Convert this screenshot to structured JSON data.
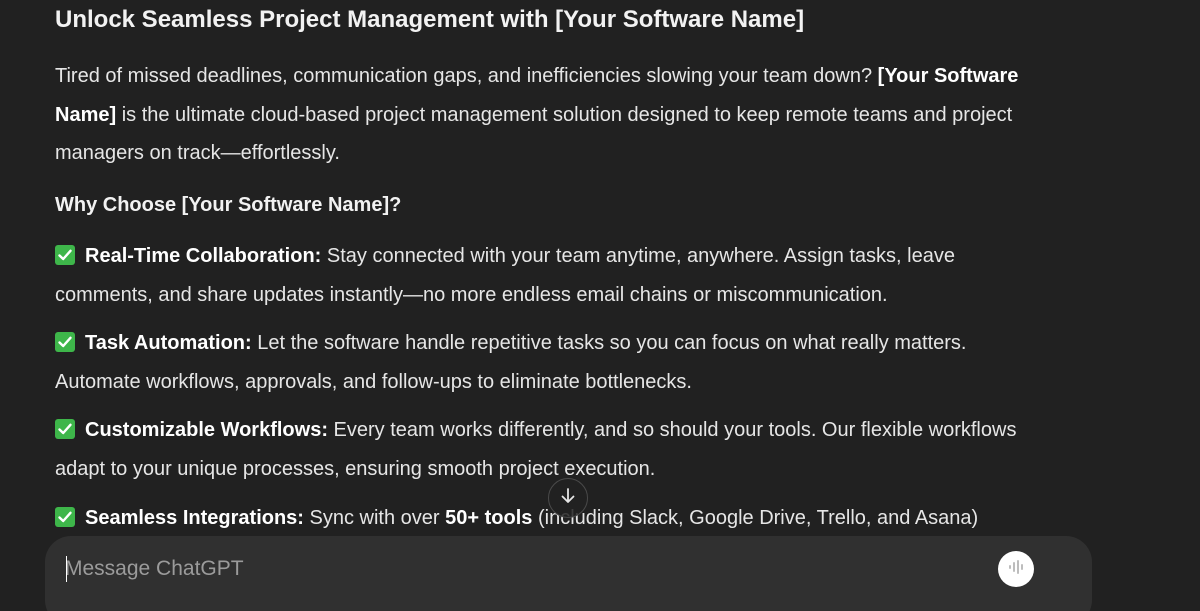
{
  "message": {
    "title": "Unlock Seamless Project Management with [Your Software Name]",
    "intro": {
      "before": "Tired of missed deadlines, communication gaps, and inefficiencies slowing your team down? ",
      "bold": "[Your Software Name]",
      "after": " is the ultimate cloud-based project management solution designed to keep remote teams and project managers on track—effortlessly."
    },
    "why_heading": "Why Choose [Your Software Name]?",
    "features": [
      {
        "icon": "check-mark-emoji",
        "label": "Real-Time Collaboration:",
        "text": " Stay connected with your team anytime, anywhere. Assign tasks, leave comments, and share updates instantly—no more endless email chains or miscommunication."
      },
      {
        "icon": "check-mark-emoji",
        "label": "Task Automation:",
        "text": " Let the software handle repetitive tasks so you can focus on what really matters. Automate workflows, approvals, and follow-ups to eliminate bottlenecks."
      },
      {
        "icon": "check-mark-emoji",
        "label": "Customizable Workflows:",
        "text": " Every team works differently, and so should your tools. Our flexible workflows adapt to your unique processes, ensuring smooth project execution."
      },
      {
        "icon": "check-mark-emoji",
        "label": "Seamless Integrations:",
        "text_before": " Sync with over ",
        "text_bold": "50+ tools",
        "text_after": " (including Slack, Google Drive, Trello, and Asana)"
      }
    ]
  },
  "scroll_button": {
    "icon": "arrow-down-icon"
  },
  "composer": {
    "placeholder": "Message ChatGPT",
    "value": "",
    "voice_icon": "voice-mode-icon"
  },
  "colors": {
    "background": "#212121",
    "composer": "#303030",
    "check_green": "#3eb64a",
    "text": "#ececec"
  }
}
